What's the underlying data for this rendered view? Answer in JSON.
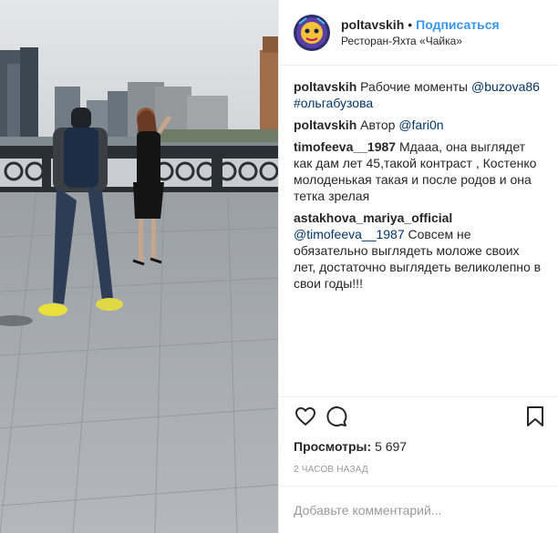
{
  "post": {
    "header": {
      "username": "poltavskih",
      "separator": "•",
      "follow_label": "Подписаться",
      "location": "Ресторан-Яхта «Чайка»"
    },
    "comments": [
      {
        "author": "poltavskih",
        "text": "Рабочие моменты ",
        "mention": "@buzova86",
        "hashtag": "#ольгабузова"
      },
      {
        "author": "poltavskih",
        "text": "Автор ",
        "mention": "@fari0n"
      },
      {
        "author": "timofeeva__1987",
        "text": "Мдааа, она выглядет как дам лет 45,такой контраст , Костенко молоденькая такая и после родов и она тетка зрелая"
      },
      {
        "author": "astakhova_mariya_official",
        "mention": "@timofeeva__1987",
        "text": "Совсем не обязательно выглядеть моложе своих лет, достаточно выглядеть великолепно в свои годы!!!"
      }
    ],
    "actions": {
      "like_icon": "heart-icon",
      "comment_icon": "comment-icon",
      "save_icon": "bookmark-icon"
    },
    "views": {
      "label": "Просмотры:",
      "count": "5 697"
    },
    "time": "2 часов назад",
    "add_comment_placeholder": "Добавьте комментарий...",
    "colors": {
      "link": "#003569",
      "follow": "#3897f0",
      "muted": "#999999",
      "divider": "#efefef"
    }
  }
}
